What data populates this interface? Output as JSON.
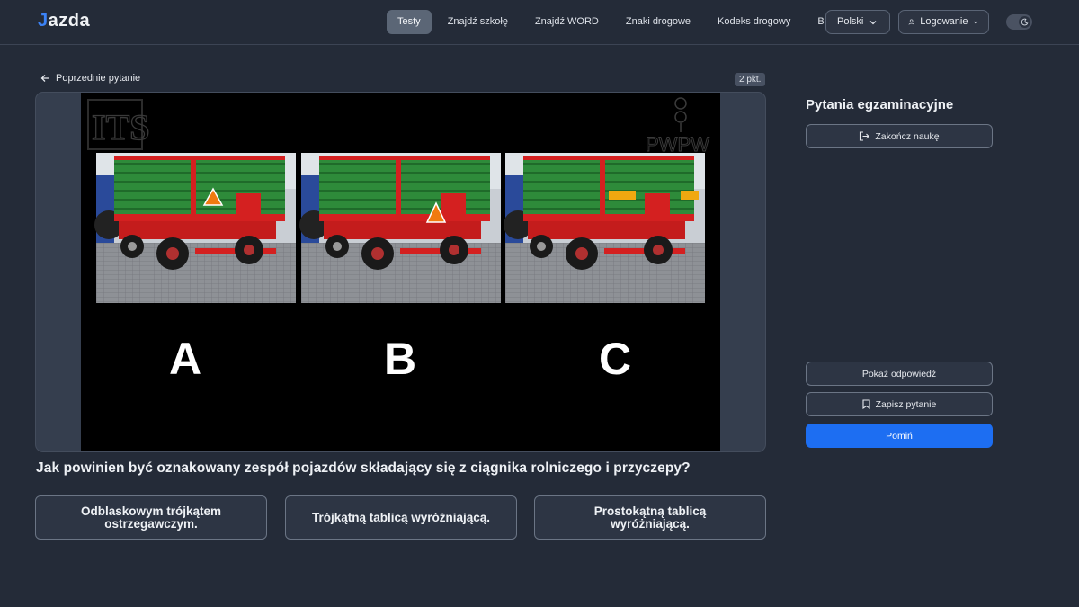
{
  "header": {
    "logo_mark": "J",
    "logo_text": "azda",
    "nav": [
      {
        "label": "Testy",
        "active": true
      },
      {
        "label": "Znajdź szkołę",
        "active": false
      },
      {
        "label": "Znajdź WORD",
        "active": false
      },
      {
        "label": "Znaki drogowe",
        "active": false
      },
      {
        "label": "Kodeks drogowy",
        "active": false
      },
      {
        "label": "Blog",
        "active": false
      }
    ],
    "language": "Polski",
    "login": "Logowanie",
    "theme_toggle_icon": "moon-icon"
  },
  "question": {
    "prev_label": "Poprzednie pytanie",
    "points": "2 pkt.",
    "image_letters": [
      "A",
      "B",
      "C"
    ],
    "image_logo_left": "ITS",
    "image_logo_right": "PWPW",
    "text": "Jak powinien być oznakowany zespół pojazdów składający się z ciągnika rolniczego i przyczepy?",
    "answers": [
      "Odblaskowym trójkątem ostrzegawczym.",
      "Trójkątną tablicą wyróżniającą.",
      "Prostokątną tablicą wyróżniającą."
    ]
  },
  "sidebar": {
    "title": "Pytania egzaminacyjne",
    "finish_label": "Zakończ naukę",
    "show_answer_label": "Pokaż odpowiedź",
    "save_label": "Zapisz pytanie",
    "skip_label": "Pomiń"
  },
  "colors": {
    "background": "#242b38",
    "accent": "#1d6ef2",
    "trailer_green": "#2e8b3a",
    "trailer_red": "#d42020"
  }
}
